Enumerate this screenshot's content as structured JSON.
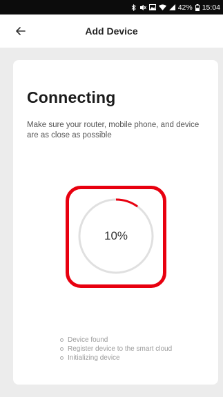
{
  "status_bar": {
    "battery": "42%",
    "time": "15:04"
  },
  "header": {
    "title": "Add Device"
  },
  "card": {
    "title": "Connecting",
    "description": "Make sure your router, mobile phone, and device are as close as possible"
  },
  "progress": {
    "value": 10,
    "label": "10%"
  },
  "steps": [
    {
      "label": "Device found"
    },
    {
      "label": "Register device to the smart cloud"
    },
    {
      "label": "Initializing device"
    }
  ],
  "colors": {
    "accent": "#e8000f",
    "progress_track": "#e0e0e0",
    "progress_fill": "#e8000f"
  }
}
